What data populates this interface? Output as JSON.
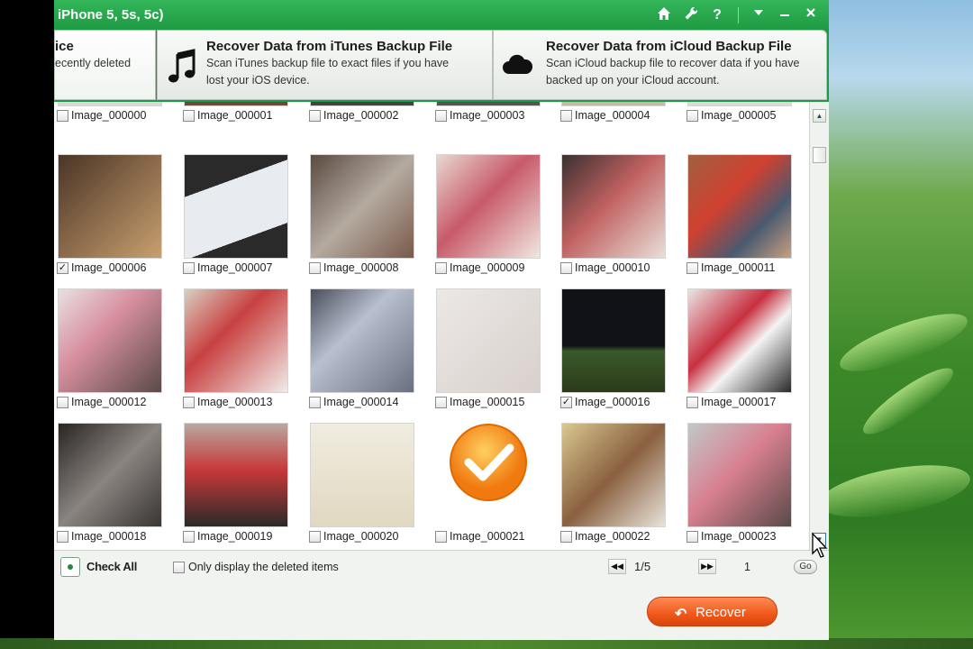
{
  "window": {
    "title": "iPhone 5, 5s, 5c)",
    "title_icons": [
      "home-icon",
      "wrench-icon",
      "help-icon",
      "dropdown-icon",
      "minimize-icon",
      "close-icon"
    ]
  },
  "modes": [
    {
      "title": "ice",
      "desc": [
        "ecently deleted"
      ]
    },
    {
      "title": "Recover Data from iTunes Backup File",
      "desc": [
        "Scan iTunes backup file to exact files if you have",
        "lost your iOS device."
      ],
      "icon": "music-note-icon"
    },
    {
      "title": "Recover Data from iCloud Backup File",
      "desc": [
        "Scan iCloud backup file to recover data if you have",
        "backed up on your iCloud account."
      ],
      "icon": "cloud-icon"
    }
  ],
  "images": [
    {
      "label": "Image_000000",
      "checked": false
    },
    {
      "label": "Image_000001",
      "checked": false
    },
    {
      "label": "Image_000002",
      "checked": false
    },
    {
      "label": "Image_000003",
      "checked": false
    },
    {
      "label": "Image_000004",
      "checked": false
    },
    {
      "label": "Image_000005",
      "checked": false
    },
    {
      "label": "Image_000006",
      "checked": true
    },
    {
      "label": "Image_000007",
      "checked": false
    },
    {
      "label": "Image_000008",
      "checked": false
    },
    {
      "label": "Image_000009",
      "checked": false
    },
    {
      "label": "Image_000010",
      "checked": false
    },
    {
      "label": "Image_000011",
      "checked": false
    },
    {
      "label": "Image_000012",
      "checked": false
    },
    {
      "label": "Image_000013",
      "checked": false
    },
    {
      "label": "Image_000014",
      "checked": false
    },
    {
      "label": "Image_000015",
      "checked": false
    },
    {
      "label": "Image_000016",
      "checked": true
    },
    {
      "label": "Image_000017",
      "checked": false
    },
    {
      "label": "Image_000018",
      "checked": false
    },
    {
      "label": "Image_000019",
      "checked": false
    },
    {
      "label": "Image_000020",
      "checked": false
    },
    {
      "label": "Image_000021",
      "checked": false
    },
    {
      "label": "Image_000022",
      "checked": false
    },
    {
      "label": "Image_000023",
      "checked": false
    }
  ],
  "footer": {
    "check_all_label": "Check All",
    "only_deleted_label": "Only display the deleted items",
    "page_count": "1/5",
    "page_input": "1",
    "go_label": "Go",
    "recover_label": "Recover"
  },
  "colors": {
    "brand_green": "#1e9a43",
    "recover_orange": "#f0581a"
  }
}
